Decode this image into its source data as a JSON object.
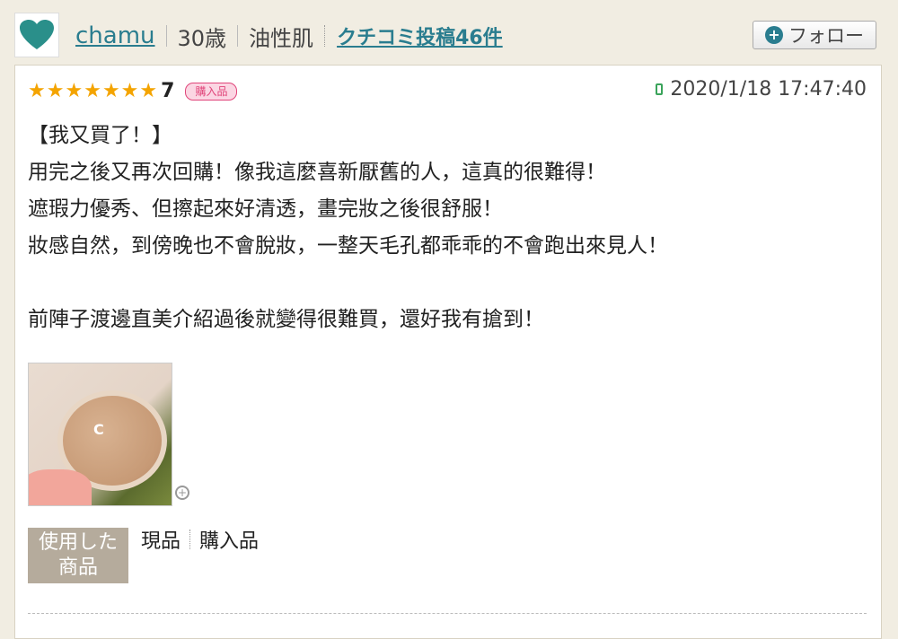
{
  "user": {
    "name": "chamu",
    "age": "30歳",
    "skin_type": "油性肌",
    "posts_link": "クチコミ投稿46件",
    "follow_label": "フォロー"
  },
  "review": {
    "score": "7",
    "star_count": 7,
    "badge": "購入品",
    "date": "2020/1/18 17:47:40",
    "lines": [
      "【我又買了！】",
      "用完之後又再次回購！像我這麼喜新厭舊的人，這真的很難得！",
      "遮瑕力優秀、但擦起來好清透，畫完妝之後很舒服！",
      "妝感自然，到傍晚也不會脫妝，一整天毛孔都乖乖的不會跑出來見人！",
      "",
      "前陣子渡邊直美介紹過後就變得很難買，還好我有搶到！"
    ]
  },
  "product": {
    "tag_line1": "使用した",
    "tag_line2": "商品",
    "value1": "現品",
    "value2": "購入品"
  },
  "icons": {
    "avatar": "heart-icon",
    "follow": "plus-circle-icon",
    "date": "mobile-phone-icon",
    "zoom": "zoom-in-icon"
  },
  "colors": {
    "accent": "#2a7d8f",
    "star": "#f4a400",
    "badge": "#e0457a"
  }
}
